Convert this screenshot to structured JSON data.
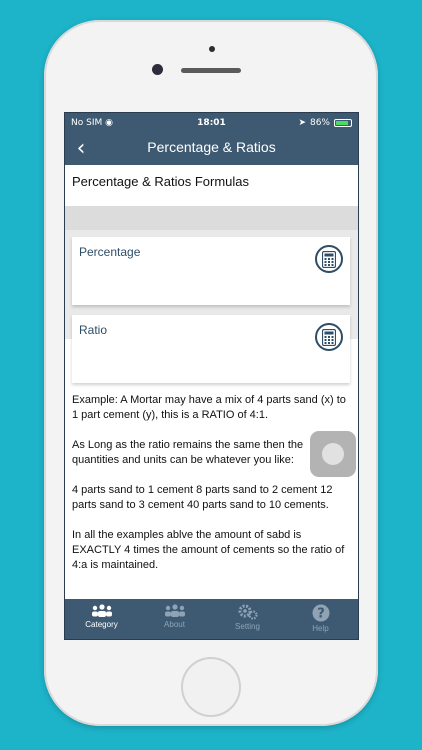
{
  "status_bar": {
    "carrier": "No SIM",
    "time": "18:01",
    "battery": "86%"
  },
  "nav": {
    "back_icon": "chevron-left-icon",
    "title": "Percentage & Ratios"
  },
  "section": {
    "title": "Percentage & Ratios Formulas"
  },
  "cards": [
    {
      "label": "Percentage",
      "icon": "calculator-icon"
    },
    {
      "label": "Ratio",
      "icon": "calculator-icon"
    }
  ],
  "paragraphs": [
    "Example: A Mortar may have a mix of 4 parts sand (x) to 1 part cement (y), this is a RATIO of 4:1.",
    "As Long as the ratio remains the same then the quantities and units can be whatever you like:",
    "4 parts sand to 1 cement 8 parts sand to 2 cement 12 parts sand to 3 cement 40 parts sand to 10 cements.",
    "In all the examples ablve the amount of sabd is EXACTLY 4 times the amount of cements so the ratio of 4:a is maintained."
  ],
  "tabs": [
    {
      "label": "Category",
      "icon": "people-icon",
      "active": true
    },
    {
      "label": "About",
      "icon": "group-icon",
      "active": false
    },
    {
      "label": "Setting",
      "icon": "gears-icon",
      "active": false
    },
    {
      "label": "Help",
      "icon": "question-icon",
      "active": false
    }
  ],
  "colors": {
    "background": "#1db3c9",
    "bar": "#3e5a72",
    "accent": "#2e4d66"
  }
}
